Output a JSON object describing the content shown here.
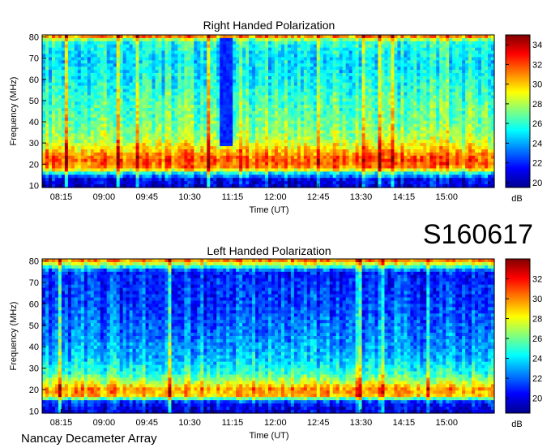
{
  "station_id": "S160617",
  "footer": "Nancay Decameter Array",
  "chart_data": [
    {
      "type": "heatmap",
      "title": "Right Handed Polarization",
      "xlabel": "Time (UT)",
      "ylabel": "Frequency (MHz)",
      "colorbar_label": "dB",
      "x_ticks": [
        "08:15",
        "09:00",
        "09:45",
        "10:30",
        "11:15",
        "12:00",
        "12:45",
        "13:30",
        "14:15",
        "15:00"
      ],
      "xlim": [
        "07:55",
        "15:50"
      ],
      "y_ticks": [
        10,
        20,
        30,
        40,
        50,
        60,
        70,
        80
      ],
      "ylim": [
        9,
        81
      ],
      "colorbar_ticks": [
        20,
        22,
        24,
        26,
        28,
        30,
        32,
        34
      ],
      "clim": [
        19.5,
        35
      ],
      "intensity_profile": [
        {
          "freq_mhz": 10,
          "db": 21
        },
        {
          "freq_mhz": 13,
          "db": 21.5
        },
        {
          "freq_mhz": 16,
          "db": 26
        },
        {
          "freq_mhz": 18,
          "db": 31
        },
        {
          "freq_mhz": 22,
          "db": 32
        },
        {
          "freq_mhz": 27,
          "db": 30
        },
        {
          "freq_mhz": 32,
          "db": 28
        },
        {
          "freq_mhz": 40,
          "db": 27
        },
        {
          "freq_mhz": 50,
          "db": 26.5
        },
        {
          "freq_mhz": 60,
          "db": 25.5
        },
        {
          "freq_mhz": 70,
          "db": 25
        },
        {
          "freq_mhz": 78,
          "db": 26
        },
        {
          "freq_mhz": 80,
          "db": 31
        }
      ],
      "notable_features": [
        {
          "label": "quiet gap",
          "time_start": "11:00",
          "time_end": "11:15",
          "freq_min_mhz": 28,
          "freq_max_mhz": 80,
          "db": 22
        }
      ]
    },
    {
      "type": "heatmap",
      "title": "Left Handed Polarization",
      "xlabel": "Time (UT)",
      "ylabel": "Frequency (MHz)",
      "colorbar_label": "dB",
      "x_ticks": [
        "08:15",
        "09:00",
        "09:45",
        "10:30",
        "11:15",
        "12:00",
        "12:45",
        "13:30",
        "14:15",
        "15:00"
      ],
      "xlim": [
        "07:55",
        "15:50"
      ],
      "y_ticks": [
        10,
        20,
        30,
        40,
        50,
        60,
        70,
        80
      ],
      "ylim": [
        9,
        81
      ],
      "colorbar_ticks": [
        20,
        22,
        24,
        26,
        28,
        30,
        32
      ],
      "clim": [
        18.5,
        34
      ],
      "intensity_profile": [
        {
          "freq_mhz": 10,
          "db": 20
        },
        {
          "freq_mhz": 14,
          "db": 21
        },
        {
          "freq_mhz": 17,
          "db": 29
        },
        {
          "freq_mhz": 20,
          "db": 30
        },
        {
          "freq_mhz": 24,
          "db": 27
        },
        {
          "freq_mhz": 28,
          "db": 25
        },
        {
          "freq_mhz": 35,
          "db": 23.5
        },
        {
          "freq_mhz": 45,
          "db": 22.5
        },
        {
          "freq_mhz": 60,
          "db": 21.5
        },
        {
          "freq_mhz": 75,
          "db": 21
        },
        {
          "freq_mhz": 80,
          "db": 30
        }
      ],
      "notable_features": []
    }
  ]
}
